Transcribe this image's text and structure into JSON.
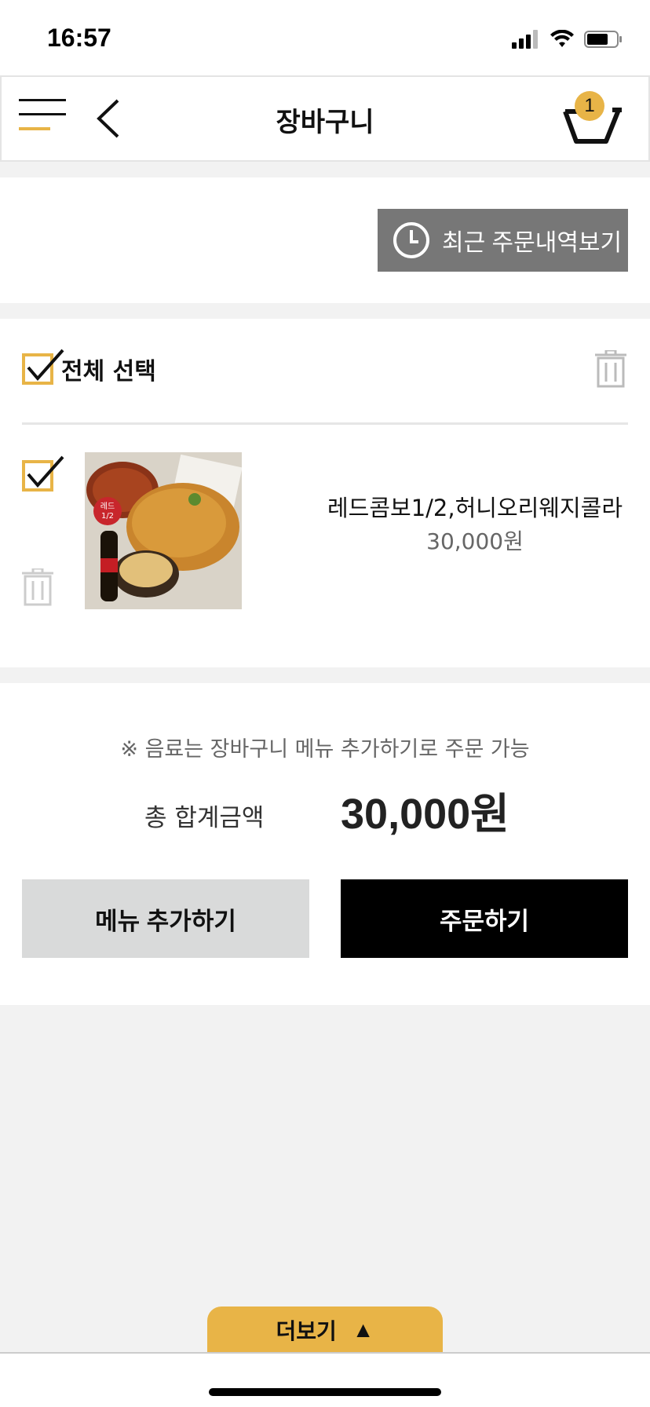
{
  "status_bar": {
    "time": "16:57"
  },
  "header": {
    "title": "장바구니",
    "cart_count": "1"
  },
  "recent_orders": {
    "label": "최근 주문내역보기"
  },
  "cart": {
    "select_all_label": "전체 선택",
    "items": [
      {
        "name": "레드콤보1/2,허니오리웨지콜라",
        "price": "30,000원",
        "badge": "레드\n1/2"
      }
    ]
  },
  "summary": {
    "notice": "※ 음료는 장바구니 메뉴 추가하기로 주문 가능",
    "total_label": "총 합계금액",
    "total_value": "30,000원"
  },
  "actions": {
    "add_menu_label": "메뉴 추가하기",
    "order_label": "주문하기"
  },
  "more": {
    "label": "더보기",
    "arrow": "▲"
  },
  "colors": {
    "accent": "#e8b447",
    "gray_button": "#777777",
    "dark": "#000000"
  }
}
